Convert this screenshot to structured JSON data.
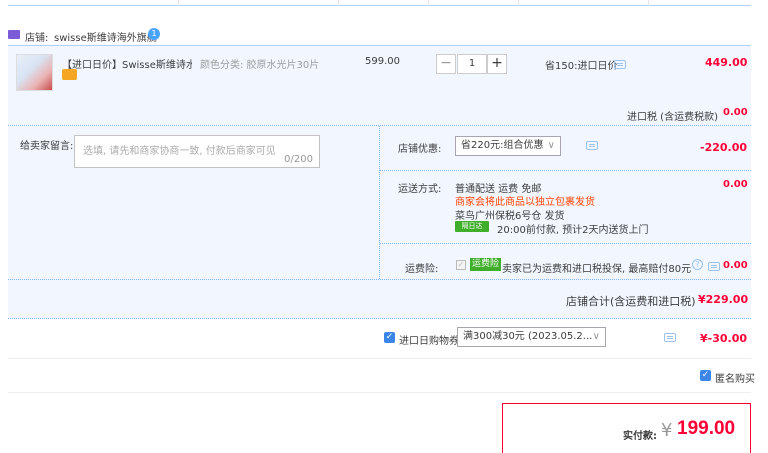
{
  "store": {
    "label": "店铺:",
    "name": "swisse斯维诗海外旗舰",
    "badge": "1"
  },
  "item": {
    "title": "【进口日价】Swisse斯维诗水...",
    "spec": "颜色分类: 胶原水光片30片",
    "unit_price": "599.00",
    "quantity": "1",
    "minus": "−",
    "plus": "+",
    "discount": "省150:进口日价",
    "total": "449.00"
  },
  "import_tax": {
    "label": "进口税 (含运费税款)",
    "value": "0.00"
  },
  "message": {
    "label": "给卖家留言:",
    "placeholder": "选填, 请先和商家协商一致, 付款后商家可见",
    "counter": "0/200"
  },
  "shop_discount": {
    "label": "店铺优惠:",
    "selected": "省220元:组合优惠",
    "value": "-220.00"
  },
  "shipping": {
    "label": "运送方式:",
    "line1": "普通配送 运费 免邮",
    "line2": "商家会将此商品以独立包裹发货",
    "line3": "菜鸟广州保税6号仓   发货",
    "tag": "隔日达",
    "line4": "20:00前付款, 预计2天内送货上门",
    "value": "0.00"
  },
  "insurance": {
    "label": "运费险:",
    "badge": "运费险",
    "text": "卖家已为运费和进口税投保, 最高赔付80元",
    "value": "0.00"
  },
  "shop_total": {
    "label": "店铺合计(含运费和进口税)",
    "value": "¥229.00"
  },
  "coupon": {
    "label": "进口日购物券",
    "selected": "满300减30元 (2023.05.2...",
    "value": "¥-30.00"
  },
  "anonymous": {
    "label": "匿名购买"
  },
  "payment": {
    "label": "实付款:",
    "currency": "¥",
    "amount": "199.00"
  },
  "colors": {
    "accent_red": "#ff0036",
    "orange": "#ff4400",
    "blue": "#3b86e8",
    "light_blue_bg": "#f2f7ff"
  }
}
